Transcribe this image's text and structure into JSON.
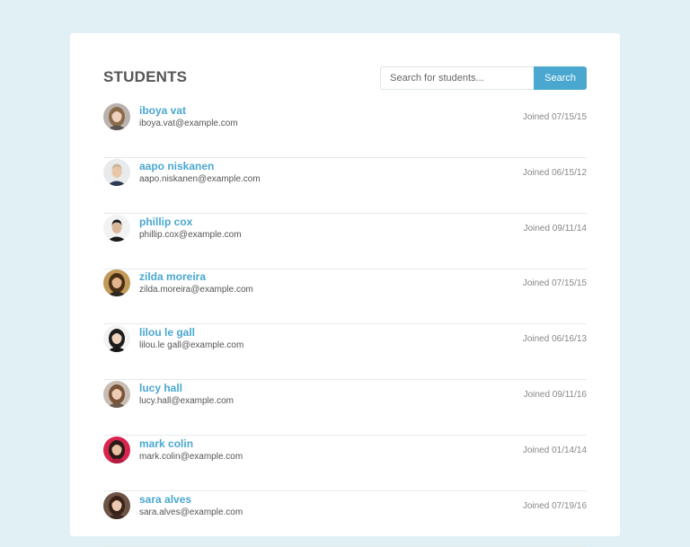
{
  "page": {
    "title": "STUDENTS",
    "search": {
      "placeholder": "Search for students...",
      "button_label": "Search"
    }
  },
  "colors": {
    "background": "#e1f0f5",
    "accent": "#4aa8d0",
    "card": "#ffffff"
  },
  "students": [
    {
      "name": "iboya vat",
      "email": "iboya.vat@example.com",
      "joined": "Joined 07/15/15",
      "avatar_icon": "female-avatar-icon",
      "bg": "#b9b2ad",
      "hair": "#8a6a48",
      "skin": "#efd2bd",
      "shirt": "#5a5350"
    },
    {
      "name": "aapo niskanen",
      "email": "aapo.niskanen@example.com",
      "joined": "Joined 06/15/12",
      "avatar_icon": "male-avatar-icon",
      "bg": "#e9eaeb",
      "hair": "#c9b39a",
      "skin": "#e8c6a8",
      "shirt": "#2f3b52"
    },
    {
      "name": "phillip cox",
      "email": "phillip.cox@example.com",
      "joined": "Joined 09/11/14",
      "avatar_icon": "male-avatar-icon",
      "bg": "#f2f2f2",
      "hair": "#1b1b1b",
      "skin": "#d9b89a",
      "shirt": "#1a1a1a"
    },
    {
      "name": "zilda moreira",
      "email": "zilda.moreira@example.com",
      "joined": "Joined 07/15/15",
      "avatar_icon": "female-avatar-icon",
      "bg": "#c19a5a",
      "hair": "#4a2e15",
      "skin": "#e0b58d",
      "shirt": "#2d2a26"
    },
    {
      "name": "lilou le gall",
      "email": "lilou.le gall@example.com",
      "joined": "Joined 06/16/13",
      "avatar_icon": "female-avatar-icon",
      "bg": "#f3f3f3",
      "hair": "#1d1d1d",
      "skin": "#efd3be",
      "shirt": "#161616"
    },
    {
      "name": "lucy hall",
      "email": "lucy.hall@example.com",
      "joined": "Joined 09/11/16",
      "avatar_icon": "female-avatar-icon",
      "bg": "#c8bdb3",
      "hair": "#7a5238",
      "skin": "#edcdb4",
      "shirt": "#6d5a4d"
    },
    {
      "name": "mark colin",
      "email": "mark.colin@example.com",
      "joined": "Joined 01/14/14",
      "avatar_icon": "female-avatar-icon",
      "bg": "#d8244f",
      "hair": "#2b1b17",
      "skin": "#e8c0a2",
      "shirt": "#b21d3f"
    },
    {
      "name": "sara alves",
      "email": "sara.alves@example.com",
      "joined": "Joined 07/19/16",
      "avatar_icon": "female-avatar-icon",
      "bg": "#6e5347",
      "hair": "#3a2118",
      "skin": "#ecc9b0",
      "shirt": "#3d2a22"
    }
  ]
}
